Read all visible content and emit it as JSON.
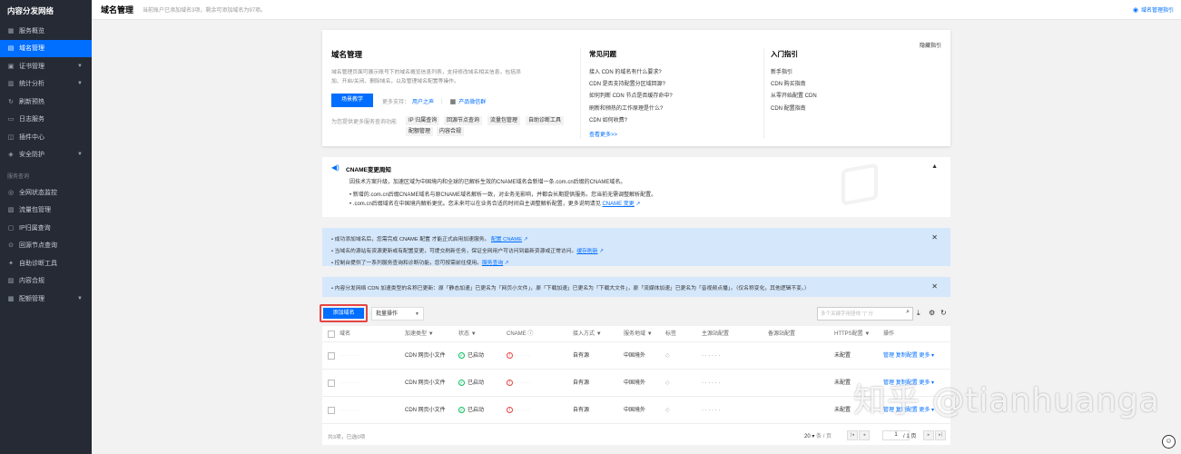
{
  "sidebar": {
    "brand": "内容分发网络",
    "items": [
      {
        "label": "服务概览",
        "icon": "grid-icon"
      },
      {
        "label": "域名管理",
        "icon": "domain-icon",
        "active": true
      },
      {
        "label": "证书管理",
        "icon": "certificate-icon",
        "caret": true
      },
      {
        "label": "统计分析",
        "icon": "chart-icon",
        "caret": true
      },
      {
        "label": "刷新预热",
        "icon": "refresh-icon"
      },
      {
        "label": "日志服务",
        "icon": "log-icon"
      },
      {
        "label": "插件中心",
        "icon": "plugin-icon"
      },
      {
        "label": "安全防护",
        "icon": "shield-icon",
        "caret": true
      }
    ],
    "group_label": "服务查询",
    "group_items": [
      {
        "label": "全网状态监控",
        "icon": "monitor-icon"
      },
      {
        "label": "流量包管理",
        "icon": "package-icon"
      },
      {
        "label": "IP归属查询",
        "icon": "ip-icon"
      },
      {
        "label": "回源节点查询",
        "icon": "node-icon"
      },
      {
        "label": "自助诊断工具",
        "icon": "diagnose-icon"
      },
      {
        "label": "内容合规",
        "icon": "compliance-icon"
      },
      {
        "label": "配额管理",
        "icon": "quota-icon",
        "caret": true
      }
    ]
  },
  "topbar": {
    "title": "域名管理",
    "subtitle": "当前账户已添加域名3项，剩余可添加域名为97项。",
    "guide": "域名管理指引"
  },
  "intro": {
    "title": "域名管理",
    "desc": "域名管理页面可展示账号下的域名概览信息列表，支持修改域名相关信息，包括添加、开启/关闭、删除域名，以及管理域名配置等操作。",
    "scene_button": "场景教学",
    "support_label": "更多支持：",
    "support_link": "用户之声",
    "support_sep": "|",
    "wechat": "产品微信群",
    "services_label": "为您提供更多服务查询功能",
    "chips": [
      "IP 归属查询",
      "回源节点查询",
      "流量包管理",
      "自助诊断工具",
      "配额管理",
      "内容合规"
    ],
    "faq_title": "常见问题",
    "faq": [
      "接入 CDN 的域名有什么要求?",
      "CDN 是否支持配置分区域回源?",
      "如何判断 CDN 节点是否缓存命中?",
      "刷新和预热的工作原理是什么?",
      "CDN 如何收费?"
    ],
    "faq_more": "查看更多>>",
    "guide_title": "入门指引",
    "guides": [
      "新手指引",
      "CDN 购买指南",
      "从零开始配置 CDN",
      "CDN 配置指南"
    ],
    "hide_guide": "隐藏指引"
  },
  "notice": {
    "title": "CNAME变更周知",
    "line1": "因技术方案升级，加速区域为中国境内和全球的已解析生效的CNAME域名会新增一条.com.cn后缀的CNAME域名。",
    "bullet1": "新增的.com.cn后缀CNAME域名与原CNAME域名解析一致，对业务无影响，并都会长期提供服务。您当前无需调整解析配置。",
    "bullet2": ".com.cn后缀域名在中国境内解析更优。您未来可以在业务合适的时间自主调整解析配置，更多说明请见",
    "bullet2_link": "CNAME 变更"
  },
  "alerts": {
    "line1": "成功添加域名后，您需完成 CNAME 配置 才能正式启用加速服务。",
    "line1_link": "配置 CNAME",
    "line2": "当域名的源站有资源更新或有配置变更，可提交刷新任务，保证全网用户可访问到最新资源或正常访问。",
    "line2_link": "缓存刷新",
    "line3": "控制台提供了一系列服务查询和诊断功能，您可按需前往使用。",
    "line3_link": "服务查询",
    "rename": "内容分发网络 CDN 加速类型的名称已更新：原「静态加速」已更名为「网页小文件」，原「下载加速」已更名为「下载大文件」，原「流媒体加速」已更名为「音视频点播」。（仅名称变化，其他逻辑不变。）"
  },
  "toolbar": {
    "add_button": "添加域名",
    "bulk": "批量操作",
    "search_placeholder": "多个关键字用竖线 \"|\" 分"
  },
  "table": {
    "headers": [
      "域名",
      "加速类型",
      "状态",
      "CNAME",
      "接入方式",
      "服务地域",
      "标签",
      "主源站配置",
      "备源站配置",
      "HTTPS配置",
      "操作"
    ],
    "rows": [
      {
        "domain": "· · · · · · · ·",
        "type": "CDN 网页小文件",
        "status": "已启动",
        "cname": "· · · · · ·",
        "access": "自有源",
        "region": "中国境外",
        "origin": "· · · · · ·",
        "https": "未配置",
        "actions": [
          "管理",
          "复制配置",
          "更多"
        ]
      },
      {
        "domain": "· · · · · · · ·",
        "type": "CDN 网页小文件",
        "status": "已启动",
        "cname": "· · · · · ·",
        "access": "自有源",
        "region": "中国境外",
        "origin": "· · · · · ·",
        "https": "未配置",
        "actions": [
          "管理",
          "复制配置",
          "更多"
        ]
      },
      {
        "domain": "· · · · · · · ·",
        "type": "CDN 网页小文件",
        "status": "已启动",
        "cname": "· · · · · ·",
        "access": "自有源",
        "region": "中国境外",
        "origin": "· · · · · ·",
        "https": "未配置",
        "actions": [
          "管理",
          "复制配置",
          "更多"
        ]
      }
    ],
    "total": "共3项，已选0项",
    "page_size": "20",
    "page_size_unit": "条 / 页",
    "page": "1",
    "page_total": "/ 1 页"
  },
  "watermark": "知乎 @tianhuanga"
}
